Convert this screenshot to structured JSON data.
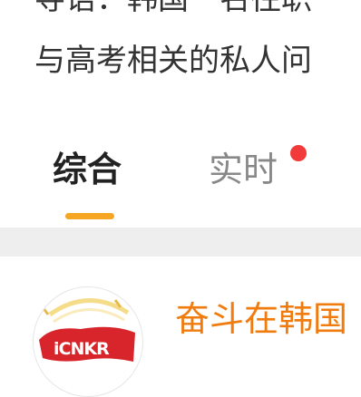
{
  "article": {
    "line1": "导语：韩国一名往职",
    "line2": "与高考相关的私人问"
  },
  "tabs": [
    {
      "label": "综合",
      "active": true
    },
    {
      "label": "实时",
      "active": false,
      "has_notification_dot": true
    }
  ],
  "post": {
    "avatar_logo_text": "iCNKR",
    "account_name": "奋斗在韩国"
  },
  "colors": {
    "accent_underline": "#f5a623",
    "notification_dot": "#f23a3a",
    "account_name": "#f07b0f",
    "logo_red": "#d8242b"
  },
  "icons": {
    "notification": "red-dot",
    "avatar": "icnkr-logo"
  }
}
